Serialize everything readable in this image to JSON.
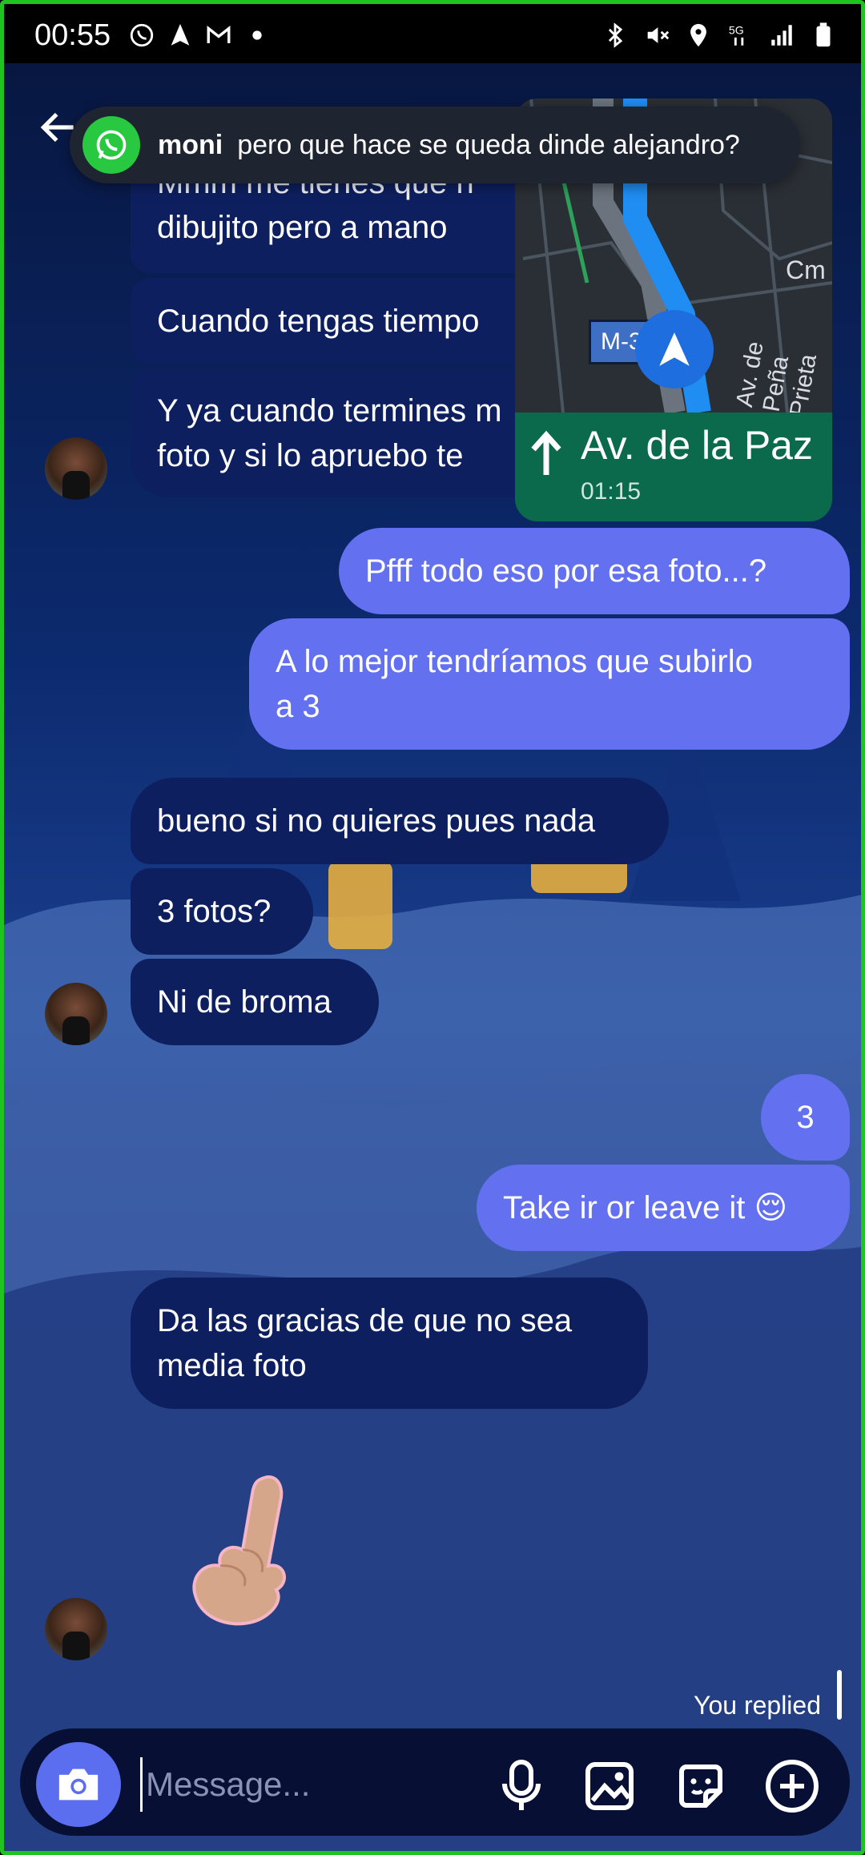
{
  "status_bar": {
    "time": "00:55"
  },
  "notification": {
    "app_icon": "whatsapp-icon",
    "sender": "moni",
    "text": "pero que hace se queda dinde alejandro?"
  },
  "map_widget": {
    "street": "Av. de la Paz",
    "eta": "01:15",
    "route": "M-30",
    "labels": [
      "Av. de Peña Prieta",
      "Cm"
    ]
  },
  "messages": {
    "m1": "Mmm me tienes que h\ndibujito pero a mano",
    "m1a": "Mmm me tienes que h",
    "m1b": "dibujito pero a mano",
    "m2": "Cuando tengas tiempo",
    "m3a": "Y ya cuando termines m",
    "m3b": "foto y si lo apruebo te",
    "m4": "Pfff todo eso por esa foto...?",
    "m5a": "A lo mejor tendríamos que subirlo",
    "m5b": "a 3",
    "m6": "bueno si no quieres pues nada",
    "m7": "3 fotos?",
    "m8": "Ni de broma",
    "m9": "3",
    "m10": "Take ir or leave it 😌",
    "m11a": "Da las gracias de que no sea",
    "m11b": "media foto"
  },
  "replied_label": "You replied",
  "composer": {
    "placeholder": "Message..."
  },
  "colors": {
    "incoming_bubble": "#0d1f5f",
    "outgoing_bubble": "#6370f0",
    "map_green": "#0b6a4c",
    "whatsapp_green": "#28c840"
  }
}
